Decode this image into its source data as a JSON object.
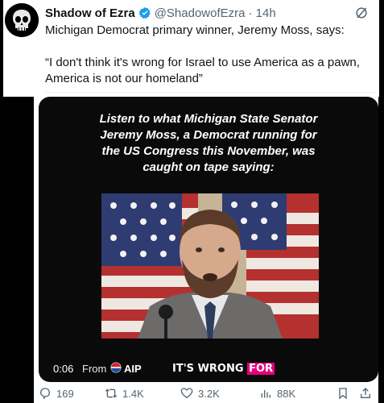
{
  "tweet": {
    "author_name": "Shadow of Ezra",
    "handle": "@ShadowofEzra",
    "time": "· 14h",
    "text_line1": "Michigan Democrat primary winner, Jeremy Moss, says:",
    "quote": "“I don't think it's wrong for Israel to use America as a pawn, America is not our homeland”"
  },
  "media": {
    "caption": "Listen to what Michigan State Senator Jeremy Moss, a Democrat running for the US Congress this November, was caught on tape saying:",
    "timestamp": "0:06",
    "from_label": "From",
    "source": "AIP",
    "subtitle_main": "IT'S WRONG ",
    "subtitle_highlight": "FOR"
  },
  "actions": {
    "replies": "169",
    "reposts": "1.4K",
    "likes": "3.2K",
    "views": "88K"
  },
  "colors": {
    "verified": "#1d9bf0",
    "text": "#0f1419",
    "muted": "#536471",
    "subtitle_highlight": "#e6007e"
  }
}
